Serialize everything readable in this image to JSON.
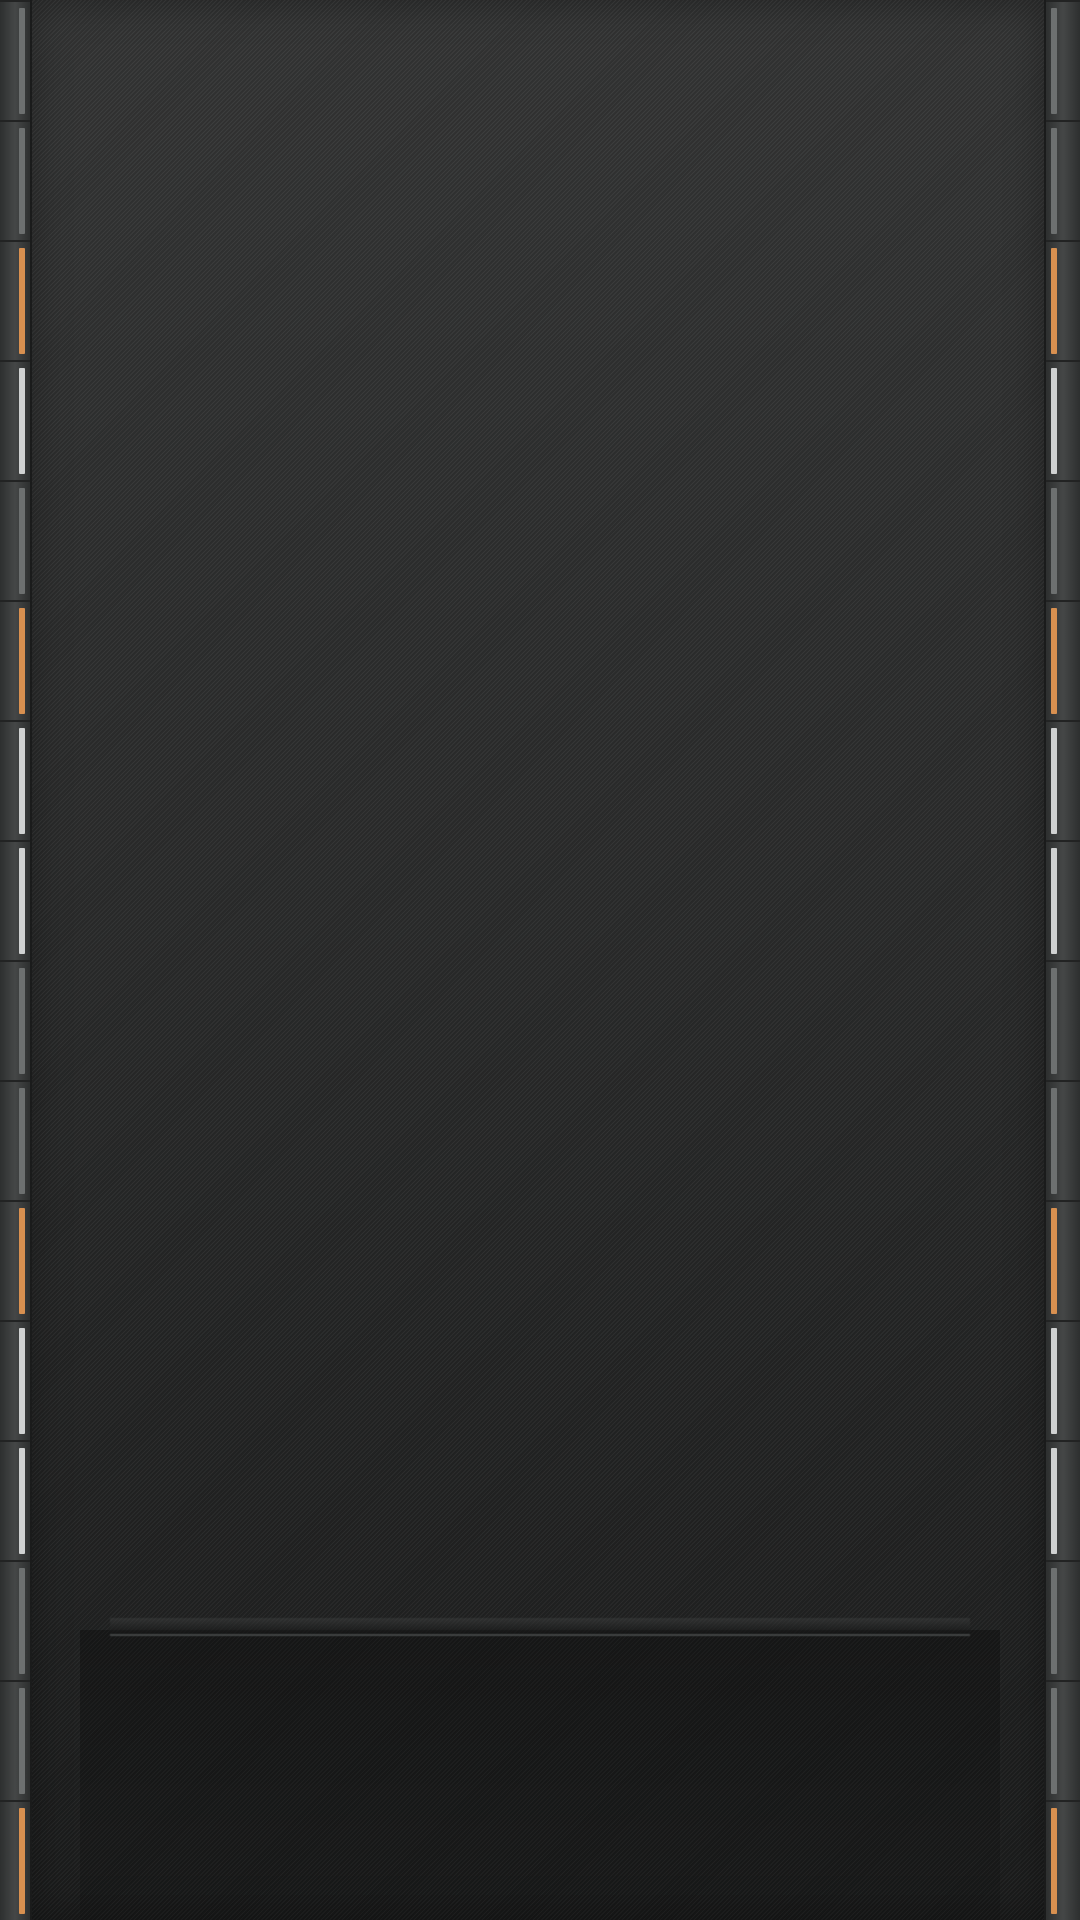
{
  "wallpaper": {
    "colors": {
      "base": "#2c2d2d",
      "orange": "#d89050",
      "white": "#cfd1d1",
      "gray": "#6d7070"
    },
    "edge_pattern": [
      "gray",
      "gray",
      "orange",
      "white",
      "gray",
      "orange",
      "white",
      "white",
      "gray",
      "gray",
      "orange",
      "white",
      "white",
      "gray",
      "gray",
      "orange"
    ]
  }
}
